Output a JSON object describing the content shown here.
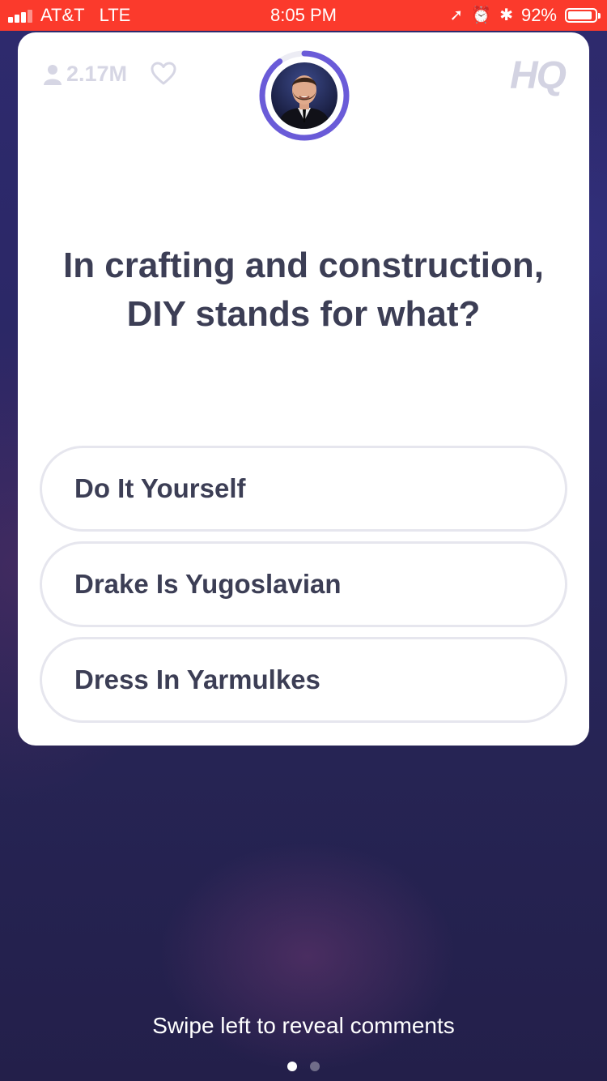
{
  "status_bar": {
    "carrier": "AT&T",
    "network": "LTE",
    "time": "8:05 PM",
    "battery_percent": "92%",
    "battery_level": 0.92,
    "bg_color": "#fb3a2c",
    "icons": [
      "signal-icon",
      "location-arrow-icon",
      "alarm-clock-icon",
      "bluetooth-icon",
      "battery-icon"
    ]
  },
  "header": {
    "viewer_count": "2.17M",
    "logo": "HQ",
    "timer_progress": 0.9,
    "timer_color": "#6a5bd8"
  },
  "question": {
    "text": "In crafting and construction, DIY stands for what?"
  },
  "answers": [
    {
      "label": "Do It Yourself"
    },
    {
      "label": "Drake Is Yugoslavian"
    },
    {
      "label": "Dress In Yarmulkes"
    }
  ],
  "footer": {
    "swipe_hint": "Swipe left to reveal comments",
    "pages": 2,
    "active_page": 1
  }
}
